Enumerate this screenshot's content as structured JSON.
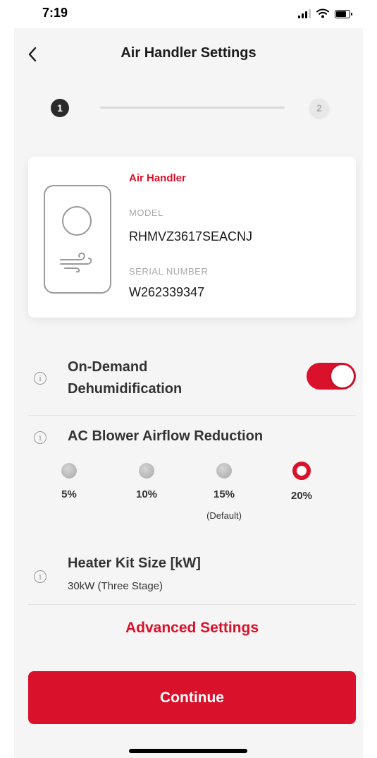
{
  "status_bar": {
    "time": "7:19"
  },
  "header": {
    "title": "Air Handler Settings"
  },
  "stepper": {
    "steps": [
      "1",
      "2"
    ],
    "current_step": 1
  },
  "device_card": {
    "type_label": "Air Handler",
    "model_label": "MODEL",
    "model_value": "RHMVZ3617SEACNJ",
    "serial_label": "SERIAL NUMBER",
    "serial_value": "W262339347"
  },
  "settings": {
    "dehumidification": {
      "title_line1": "On-Demand",
      "title_line2": "Dehumidification",
      "enabled": true
    },
    "airflow_reduction": {
      "title": "AC Blower Airflow Reduction",
      "options": [
        {
          "label": "5%",
          "note": "",
          "selected": false
        },
        {
          "label": "10%",
          "note": "",
          "selected": false
        },
        {
          "label": "15%",
          "note": "(Default)",
          "selected": false
        },
        {
          "label": "20%",
          "note": "",
          "selected": true
        }
      ]
    },
    "heater_kit": {
      "title": "Heater Kit Size [kW]",
      "value": "30kW (Three Stage)"
    }
  },
  "actions": {
    "advanced_settings": "Advanced Settings",
    "continue": "Continue"
  },
  "colors": {
    "accent": "#d9112a",
    "background": "#f5f5f5",
    "card": "#ffffff",
    "text": "#333333",
    "muted": "#a8a8a8"
  },
  "icons": {
    "back": "chevron-left-icon",
    "info": "info-icon",
    "device": "air-handler-icon"
  }
}
